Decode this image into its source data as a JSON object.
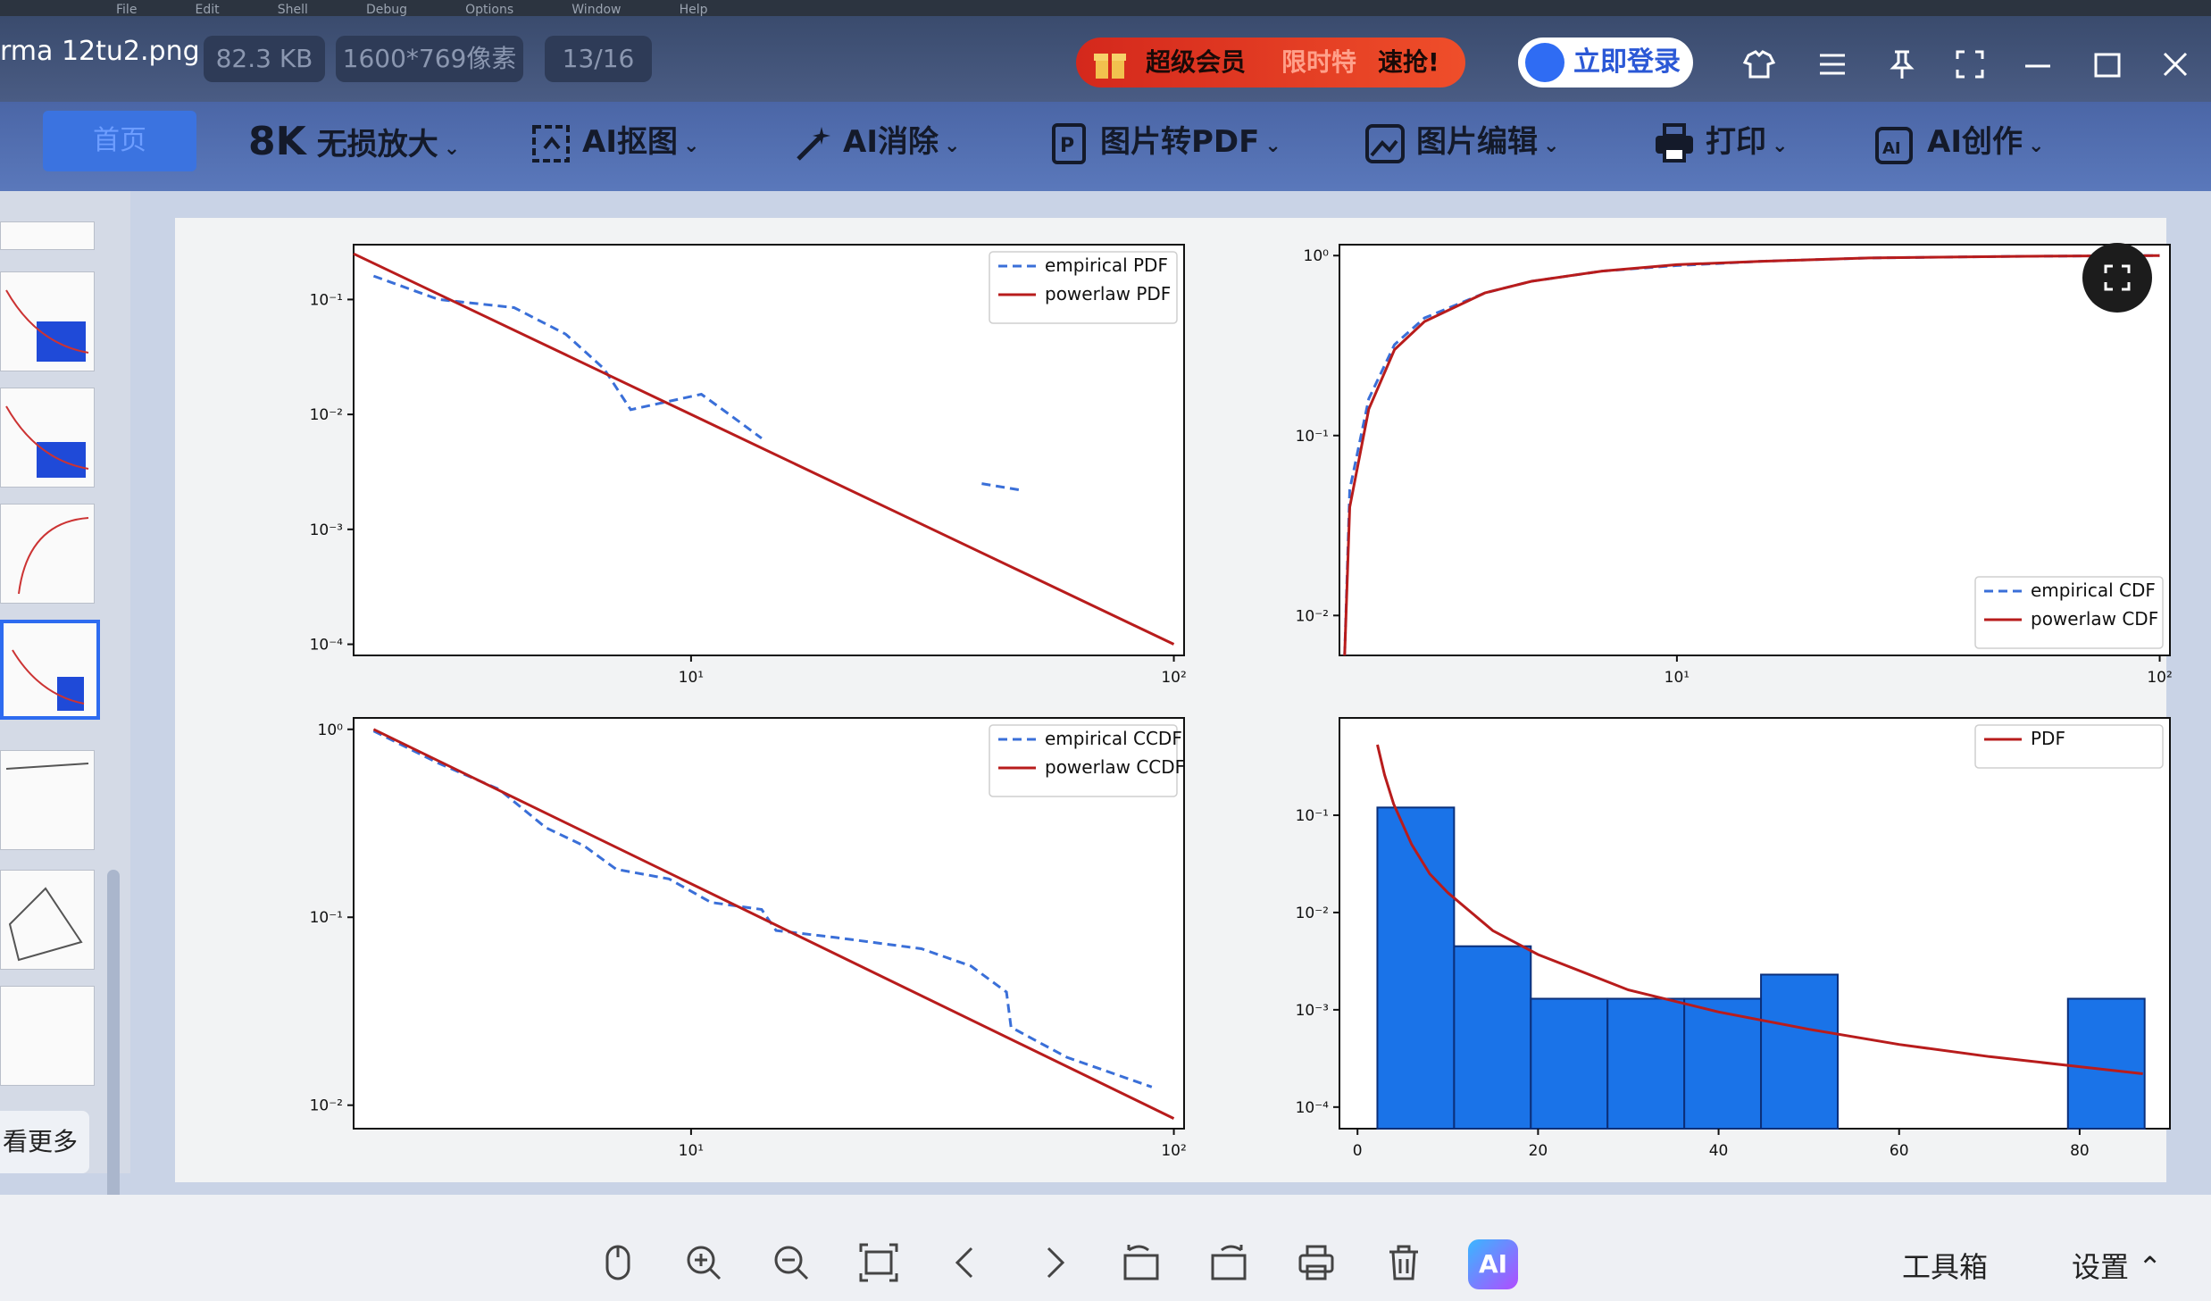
{
  "menubar": {
    "items": [
      "File",
      "Edit",
      "Shell",
      "Debug",
      "Options",
      "Window",
      "Help"
    ]
  },
  "titlebar": {
    "file_name": "rma 12tu2.png",
    "file_size": "82.3 KB",
    "dimensions": "1600*769像素",
    "page_counter": "13/16",
    "promo": {
      "part1": "超级会员",
      "part2": "限时特",
      "part3": "速抢!"
    },
    "login_label": "立即登录",
    "colors": {
      "bar": "#3a4b6d",
      "promo": "#e0301f",
      "login_text": "#2b58d6"
    }
  },
  "toolbar": {
    "home_label": "首页",
    "items": [
      {
        "label": "无损放大",
        "icon": "8k-icon",
        "icon_text": "8K"
      },
      {
        "label": "AI抠图",
        "icon": "cutout-icon"
      },
      {
        "label": "AI消除",
        "icon": "magic-wand-icon"
      },
      {
        "label": "图片转PDF",
        "icon": "pdf-icon"
      },
      {
        "label": "图片编辑",
        "icon": "image-edit-icon"
      },
      {
        "label": "打印",
        "icon": "printer-icon"
      },
      {
        "label": "AI创作",
        "icon": "ai-create-icon"
      }
    ]
  },
  "sidebar": {
    "see_more_label": "看更多"
  },
  "bottombar": {
    "icons": [
      "mouse-icon",
      "zoom-in-icon",
      "zoom-out-icon",
      "fit-screen-icon",
      "prev-icon",
      "next-icon",
      "rotate-left-icon",
      "rotate-right-icon",
      "print-icon",
      "delete-icon"
    ],
    "ai_label": "AI",
    "toolbox_label": "工具箱",
    "settings_label": "设置"
  },
  "chart_data": [
    {
      "type": "line",
      "xscale": "log",
      "yscale": "log",
      "xlim": [
        2.0,
        105
      ],
      "ylim": [
        8e-05,
        0.3
      ],
      "xticks": [
        {
          "v": 10,
          "label": "10¹"
        },
        {
          "v": 100,
          "label": "10²"
        }
      ],
      "yticks": [
        {
          "v": 0.1,
          "label": "10⁻¹"
        },
        {
          "v": 0.01,
          "label": "10⁻²"
        },
        {
          "v": 0.001,
          "label": "10⁻³"
        },
        {
          "v": 0.0001,
          "label": "10⁻⁴"
        }
      ],
      "legend": "top-right",
      "series": [
        {
          "name": "empirical PDF",
          "style": "dashed",
          "color": "#3a6fd8",
          "segments": [
            [
              [
                2.2,
                0.16
              ],
              [
                3.0,
                0.1
              ],
              [
                4.3,
                0.085
              ],
              [
                5.5,
                0.05
              ],
              [
                6.6,
                0.025
              ],
              [
                7.5,
                0.011
              ],
              [
                9.0,
                0.013
              ],
              [
                10.5,
                0.015
              ],
              [
                12,
                0.01
              ],
              [
                14,
                0.0062
              ]
            ],
            [
              [
                40,
                0.0025
              ],
              [
                48,
                0.0022
              ]
            ]
          ]
        },
        {
          "name": "powerlaw PDF",
          "style": "solid",
          "color": "#b81c1c",
          "points": [
            [
              2.0,
              0.25
            ],
            [
              100,
              0.0001
            ]
          ]
        }
      ]
    },
    {
      "type": "line",
      "xscale": "log",
      "yscale": "log",
      "xlim": [
        2.0,
        105
      ],
      "ylim": [
        0.006,
        1.15
      ],
      "xticks": [
        {
          "v": 10,
          "label": "10¹"
        },
        {
          "v": 100,
          "label": "10²"
        }
      ],
      "yticks": [
        {
          "v": 1,
          "label": "10⁰"
        },
        {
          "v": 0.1,
          "label": "10⁻¹"
        },
        {
          "v": 0.01,
          "label": "10⁻²"
        }
      ],
      "legend": "bottom-right",
      "series": [
        {
          "name": "empirical CDF",
          "style": "dashed",
          "color": "#3a6fd8",
          "segments": [
            [
              [
                2.05,
                0.006
              ],
              [
                2.1,
                0.05
              ],
              [
                2.3,
                0.16
              ],
              [
                2.6,
                0.32
              ],
              [
                3.0,
                0.45
              ],
              [
                4.0,
                0.62
              ],
              [
                5.0,
                0.72
              ],
              [
                7.0,
                0.82
              ],
              [
                10,
                0.88
              ],
              [
                15,
                0.93
              ],
              [
                25,
                0.97
              ],
              [
                50,
                0.99
              ],
              [
                100,
                1.0
              ]
            ]
          ]
        },
        {
          "name": "powerlaw CDF",
          "style": "solid",
          "color": "#b81c1c",
          "points": [
            [
              2.05,
              0.006
            ],
            [
              2.1,
              0.04
            ],
            [
              2.3,
              0.14
            ],
            [
              2.6,
              0.3
            ],
            [
              3.0,
              0.43
            ],
            [
              4.0,
              0.62
            ],
            [
              5.0,
              0.72
            ],
            [
              7.0,
              0.82
            ],
            [
              10,
              0.89
            ],
            [
              15,
              0.93
            ],
            [
              25,
              0.97
            ],
            [
              50,
              0.99
            ],
            [
              100,
              1.0
            ]
          ]
        }
      ]
    },
    {
      "type": "line",
      "xscale": "log",
      "yscale": "log",
      "xlim": [
        2.0,
        105
      ],
      "ylim": [
        0.0075,
        1.15
      ],
      "xticks": [
        {
          "v": 10,
          "label": "10¹"
        },
        {
          "v": 100,
          "label": "10²"
        }
      ],
      "yticks": [
        {
          "v": 1,
          "label": "10⁰"
        },
        {
          "v": 0.1,
          "label": "10⁻¹"
        },
        {
          "v": 0.01,
          "label": "10⁻²"
        }
      ],
      "legend": "top-right",
      "series": [
        {
          "name": "empirical CCDF",
          "style": "dashed",
          "color": "#3a6fd8",
          "segments": [
            [
              [
                2.2,
                0.98
              ],
              [
                3.0,
                0.66
              ],
              [
                4.0,
                0.48
              ],
              [
                5.0,
                0.3
              ],
              [
                6.0,
                0.24
              ],
              [
                7.0,
                0.18
              ],
              [
                9.0,
                0.16
              ],
              [
                11,
                0.12
              ],
              [
                14,
                0.11
              ],
              [
                15,
                0.085
              ],
              [
                20,
                0.078
              ],
              [
                30,
                0.068
              ],
              [
                38,
                0.055
              ],
              [
                45,
                0.04
              ],
              [
                46,
                0.026
              ],
              [
                60,
                0.018
              ],
              [
                90,
                0.0125
              ]
            ]
          ]
        },
        {
          "name": "powerlaw CCDF",
          "style": "solid",
          "color": "#b81c1c",
          "points": [
            [
              2.2,
              1.0
            ],
            [
              100,
              0.0085
            ]
          ]
        }
      ]
    },
    {
      "type": "bar",
      "xscale": "linear",
      "yscale": "log",
      "xlim": [
        -2,
        90
      ],
      "ylim": [
        6e-05,
        1.0
      ],
      "xticks": [
        {
          "v": 0,
          "label": "0"
        },
        {
          "v": 20,
          "label": "20"
        },
        {
          "v": 40,
          "label": "40"
        },
        {
          "v": 60,
          "label": "60"
        },
        {
          "v": 80,
          "label": "80"
        }
      ],
      "yticks": [
        {
          "v": 0.1,
          "label": "10⁻¹"
        },
        {
          "v": 0.01,
          "label": "10⁻²"
        },
        {
          "v": 0.001,
          "label": "10⁻³"
        },
        {
          "v": 0.0001,
          "label": "10⁻⁴"
        }
      ],
      "legend": "top-right",
      "bar_color": "#1a73e8",
      "bars": [
        {
          "x0": 2.2,
          "x1": 10.7,
          "value": 0.12
        },
        {
          "x0": 10.7,
          "x1": 19.2,
          "value": 0.0045
        },
        {
          "x0": 19.2,
          "x1": 27.7,
          "value": 0.0013
        },
        {
          "x0": 27.7,
          "x1": 36.2,
          "value": 0.0013
        },
        {
          "x0": 36.2,
          "x1": 44.7,
          "value": 0.0013
        },
        {
          "x0": 44.7,
          "x1": 53.2,
          "value": 0.0023
        },
        {
          "x0": 78.7,
          "x1": 87.2,
          "value": 0.0013
        }
      ],
      "series": [
        {
          "name": "PDF",
          "style": "solid",
          "color": "#b81c1c",
          "points": [
            [
              2.2,
              0.53
            ],
            [
              3,
              0.26
            ],
            [
              4,
              0.13
            ],
            [
              6,
              0.05
            ],
            [
              8,
              0.025
            ],
            [
              10,
              0.016
            ],
            [
              15,
              0.0065
            ],
            [
              20,
              0.0037
            ],
            [
              30,
              0.0016
            ],
            [
              40,
              0.00095
            ],
            [
              50,
              0.00063
            ],
            [
              60,
              0.00044
            ],
            [
              70,
              0.00033
            ],
            [
              80,
              0.00026
            ],
            [
              87,
              0.00022
            ]
          ]
        }
      ]
    }
  ]
}
